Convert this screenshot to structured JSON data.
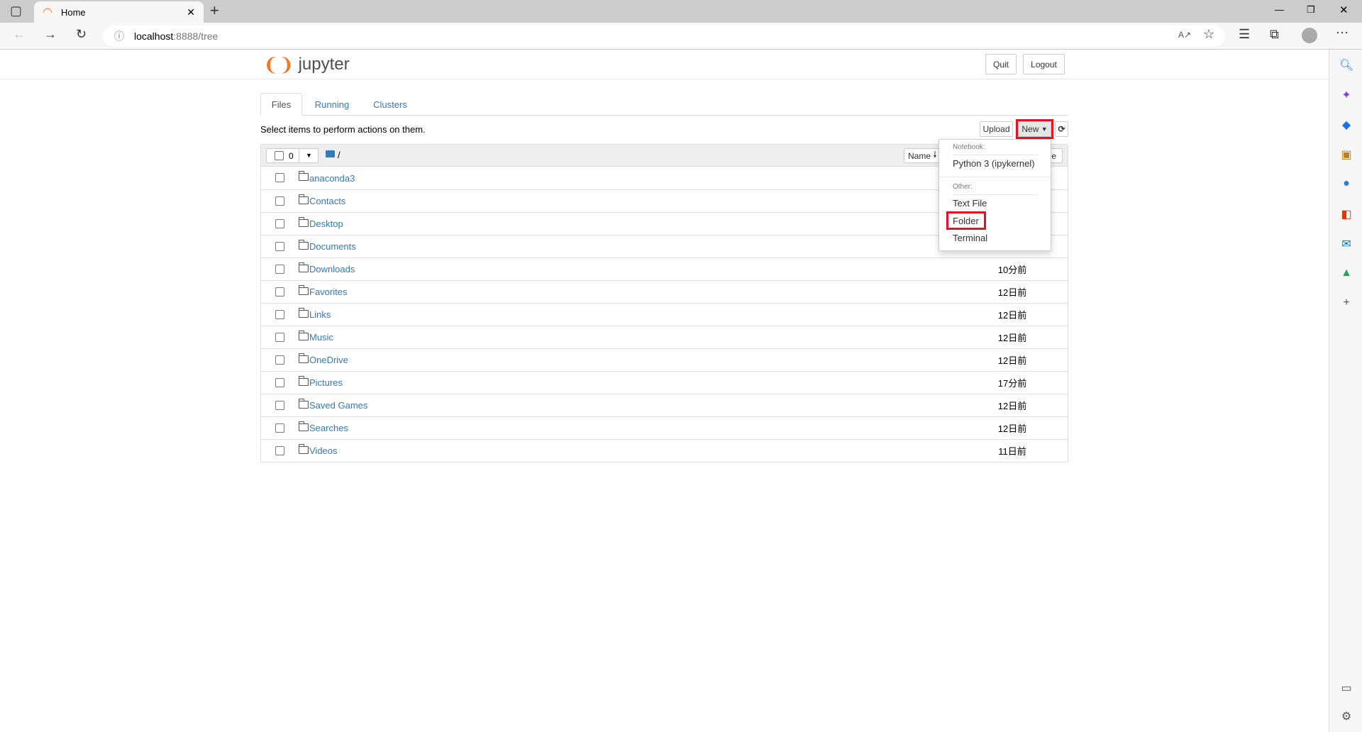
{
  "browser": {
    "tab_title": "Home",
    "url_host": "localhost",
    "url_rest": ":8888/tree"
  },
  "header": {
    "logo_text": "jupyter",
    "quit": "Quit",
    "logout": "Logout"
  },
  "tabs": [
    "Files",
    "Running",
    "Clusters"
  ],
  "toolbar": {
    "hint": "Select items to perform actions on them.",
    "upload": "Upload",
    "new": "New",
    "selected_count": "0",
    "path": "/"
  },
  "list_header": {
    "name": "Name",
    "sort_icon": "arrow-down-icon",
    "last_modified_partial": "e"
  },
  "files": [
    {
      "name": "anaconda3",
      "time": ""
    },
    {
      "name": "Contacts",
      "time": ""
    },
    {
      "name": "Desktop",
      "time": ""
    },
    {
      "name": "Documents",
      "time": ""
    },
    {
      "name": "Downloads",
      "time": "10分前"
    },
    {
      "name": "Favorites",
      "time": "12日前"
    },
    {
      "name": "Links",
      "time": "12日前"
    },
    {
      "name": "Music",
      "time": "12日前"
    },
    {
      "name": "OneDrive",
      "time": "12日前"
    },
    {
      "name": "Pictures",
      "time": "17分前"
    },
    {
      "name": "Saved Games",
      "time": "12日前"
    },
    {
      "name": "Searches",
      "time": "12日前"
    },
    {
      "name": "Videos",
      "time": "11日前"
    }
  ],
  "new_menu": {
    "notebook_header": "Notebook:",
    "python": "Python 3 (ipykernel)",
    "other_header": "Other:",
    "text_file": "Text File",
    "folder": "Folder",
    "terminal": "Terminal"
  },
  "colors": {
    "link": "#337ab7",
    "highlight": "#e81123",
    "jupyter_orange": "#f37626"
  }
}
